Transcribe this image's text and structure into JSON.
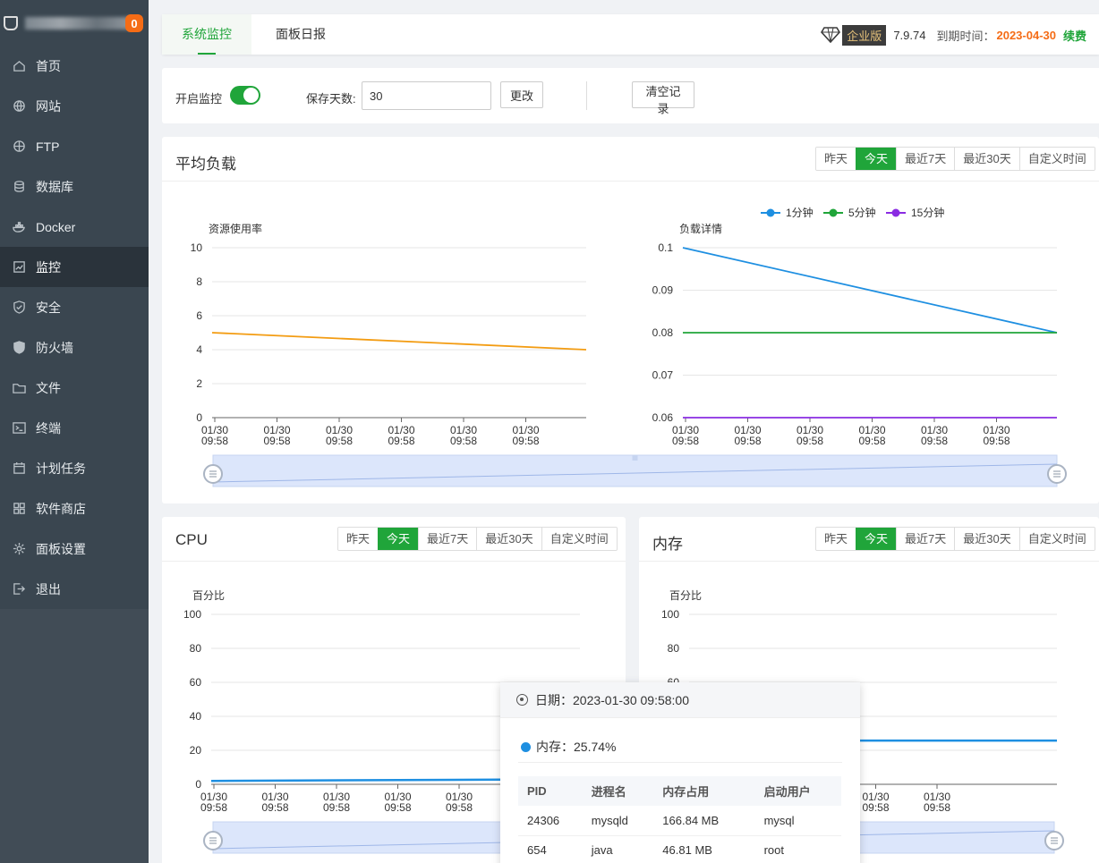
{
  "sidebar": {
    "badge": "0",
    "items": [
      {
        "label": "首页",
        "icon": "home-icon"
      },
      {
        "label": "网站",
        "icon": "globe-icon"
      },
      {
        "label": "FTP",
        "icon": "ftp-icon"
      },
      {
        "label": "数据库",
        "icon": "database-icon"
      },
      {
        "label": "Docker",
        "icon": "docker-icon"
      },
      {
        "label": "监控",
        "icon": "monitor-icon"
      },
      {
        "label": "安全",
        "icon": "shield-icon"
      },
      {
        "label": "防火墙",
        "icon": "firewall-icon"
      },
      {
        "label": "文件",
        "icon": "folder-icon"
      },
      {
        "label": "终端",
        "icon": "terminal-icon"
      },
      {
        "label": "计划任务",
        "icon": "calendar-icon"
      },
      {
        "label": "软件商店",
        "icon": "apps-icon"
      },
      {
        "label": "面板设置",
        "icon": "gear-icon"
      },
      {
        "label": "退出",
        "icon": "logout-icon"
      }
    ],
    "active_index": 5
  },
  "topbar": {
    "tabs": [
      "系统监控",
      "面板日报"
    ],
    "edition": "企业版",
    "version": "7.9.74",
    "expire_label": "到期时间：",
    "expire_date": "2023-04-30",
    "renew": "续费"
  },
  "controls": {
    "monitor_label": "开启监控",
    "monitor_on": true,
    "days_label": "保存天数:",
    "days_value": "30",
    "change_btn": "更改",
    "clear_btn": "清空记录"
  },
  "range_options": [
    "昨天",
    "今天",
    "最近7天",
    "最近30天",
    "自定义时间"
  ],
  "range_selected": "今天",
  "panels": {
    "load_title": "平均负载",
    "cpu_title": "CPU",
    "mem_title": "内存"
  },
  "colors": {
    "green": "#20a53a",
    "orange": "#f56c16",
    "load_line": "#f39c12",
    "series_1min": "#1e8fe1",
    "series_5min": "#20a53a",
    "series_15min": "#8a2be2",
    "cpu_line": "#1e8fe1"
  },
  "chart_data": [
    {
      "type": "line",
      "id": "load-usage",
      "ylabel": "资源使用率",
      "ylim": [
        0,
        10
      ],
      "yticks": [
        "10",
        "8",
        "6",
        "4",
        "2",
        "0"
      ],
      "xticks": [
        "01/30\n09:58",
        "01/30\n09:58",
        "01/30\n09:58",
        "01/30\n09:58",
        "01/30\n09:58",
        "01/30\n09:58"
      ],
      "series": [
        {
          "values": [
            5,
            4
          ]
        }
      ]
    },
    {
      "type": "line",
      "id": "load-detail",
      "ylabel": "负载详情",
      "ylim": [
        0.06,
        0.1
      ],
      "yticks": [
        "0.1",
        "0.09",
        "0.08",
        "0.07",
        "0.06"
      ],
      "xticks": [
        "01/30\n09:58",
        "01/30\n09:58",
        "01/30\n09:58",
        "01/30\n09:58",
        "01/30\n09:58",
        "01/30\n09:58"
      ],
      "legend": [
        "1分钟",
        "5分钟",
        "15分钟"
      ],
      "series": [
        {
          "name": "1分钟",
          "values": [
            0.1,
            0.08
          ]
        },
        {
          "name": "5分钟",
          "values": [
            0.08,
            0.08
          ]
        },
        {
          "name": "15分钟",
          "values": [
            0.06,
            0.06
          ]
        }
      ]
    },
    {
      "type": "line",
      "id": "cpu",
      "ylabel": "百分比",
      "ylim": [
        0,
        100
      ],
      "yticks": [
        "100",
        "80",
        "60",
        "40",
        "20",
        "0"
      ],
      "xticks": [
        "01/30\n09:58",
        "01/30\n09:58",
        "01/30\n09:58",
        "01/30\n09:58",
        "01/30\n09:58"
      ],
      "series": [
        {
          "values": [
            2,
            3
          ]
        }
      ]
    },
    {
      "type": "line",
      "id": "memory",
      "ylabel": "百分比",
      "ylim": [
        0,
        100
      ],
      "yticks": [
        "100",
        "80",
        "60"
      ],
      "xticks": [
        "01/30\n09:58",
        "01/30\n09:58",
        "01/30\n09:58"
      ],
      "series": [
        {
          "values": [
            25.74,
            25.74
          ]
        }
      ]
    }
  ],
  "tooltip": {
    "date_label": "日期：",
    "date": "2023-01-30 09:58:00",
    "mem_label": "内存：",
    "mem_value": "25.74%",
    "columns": [
      "PID",
      "进程名",
      "内存占用",
      "启动用户"
    ],
    "rows": [
      [
        "24306",
        "mysqld",
        "166.84 MB",
        "mysql"
      ],
      [
        "654",
        "java",
        "46.81 MB",
        "root"
      ]
    ]
  }
}
